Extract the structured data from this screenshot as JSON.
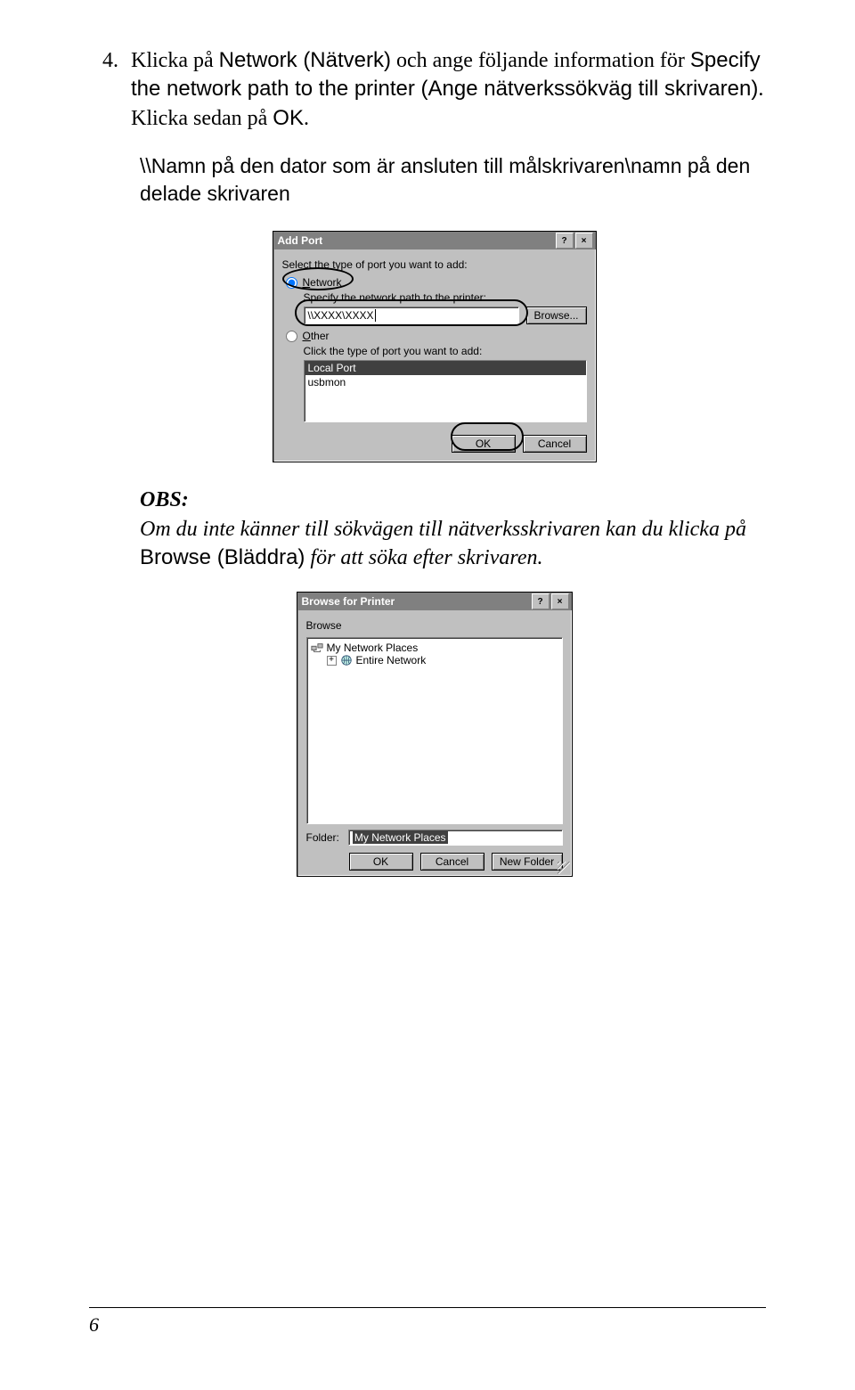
{
  "step": {
    "number": "4.",
    "text_parts": {
      "pre1": "Klicka på ",
      "sans1": "Network (Nätverk)",
      "mid1": " och ange följande information för ",
      "sans2": "Specify the network path to the printer (Ange nätverkssökväg till skrivaren)",
      "mid2": ". Klicka sedan på ",
      "sans3": "OK",
      "post": "."
    }
  },
  "path_example": "\\\\Namn på den dator som är ansluten till målskrivaren\\namn på den delade skrivaren",
  "dialog1": {
    "title": "Add Port",
    "help": "?",
    "close": "×",
    "prompt": "Select the type of port you want to add:",
    "radio_network": "Network",
    "network_sub": "Specify the network path to the printer:",
    "network_input": "\\\\XXXX\\XXXX",
    "browse": "Browse...",
    "radio_other": "Other",
    "other_sub": "Click the type of port you want to add:",
    "list_sel": "Local Port",
    "list_item": "usbmon",
    "ok": "OK",
    "cancel": "Cancel"
  },
  "obs": {
    "title": "OBS:",
    "text_parts": {
      "pre": "Om du inte känner till sökvägen till nätverksskrivaren kan du klicka på ",
      "sans": "Browse (Bläddra)",
      "post": " för att söka efter skrivaren."
    }
  },
  "dialog2": {
    "title": "Browse for Printer",
    "help": "?",
    "close": "×",
    "browse_label": "Browse",
    "tree_item1": "My Network Places",
    "tree_item2": "Entire Network",
    "folder_label": "Folder:",
    "folder_value": "My Network Places",
    "ok": "OK",
    "cancel": "Cancel",
    "newfolder": "New Folder"
  },
  "footer_page": "6"
}
